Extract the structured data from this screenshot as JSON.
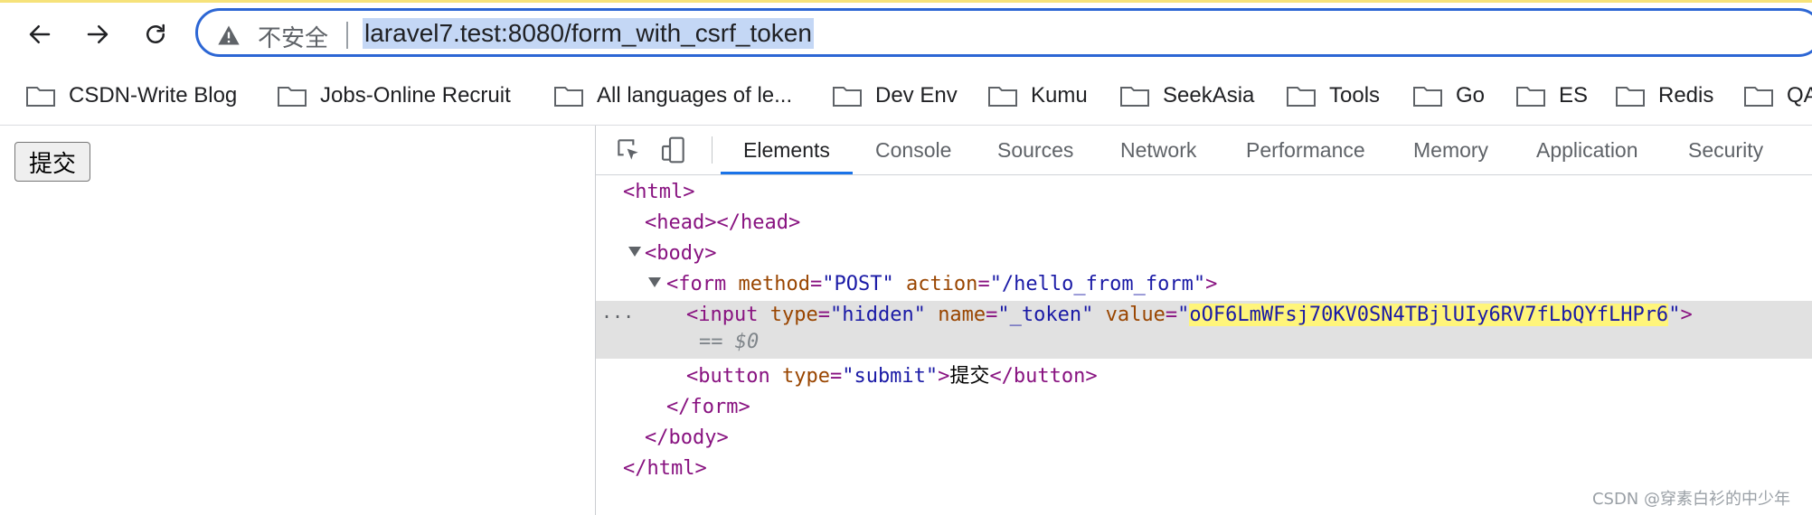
{
  "browser": {
    "nav": {
      "back_icon": "arrow-left-icon",
      "forward_icon": "arrow-right-icon",
      "reload_icon": "reload-icon"
    },
    "address_bar": {
      "security_label": "不安全",
      "url": "laravel7.test:8080/form_with_csrf_token"
    },
    "bookmarks": [
      "CSDN-Write Blog",
      "Jobs-Online Recruit",
      "All languages of le...",
      "Dev Env",
      "Kumu",
      "SeekAsia",
      "Tools",
      "Go",
      "ES",
      "Redis",
      "QA"
    ]
  },
  "page": {
    "submit_label": "提交"
  },
  "devtools": {
    "tabs": [
      "Elements",
      "Console",
      "Sources",
      "Network",
      "Performance",
      "Memory",
      "Application",
      "Security"
    ],
    "active_tab": "Elements",
    "dom": {
      "html_open": "<html>",
      "head": "<head></head>",
      "body_open": "<body>",
      "form_tag": "<form",
      "form_attr_method": "method",
      "form_val_method": "\"POST\"",
      "form_attr_action": "action",
      "form_val_action": "\"/hello_from_form\"",
      "form_close_bracket": ">",
      "input_tag": "<input",
      "input_attr_type": "type",
      "input_val_type": "\"hidden\"",
      "input_attr_name": "name",
      "input_val_name": "\"_token\"",
      "input_attr_value": "value",
      "input_val_quote_open": "\"",
      "token": "oOF6LmWFsj70KV0SN4TBjlUIy6RV7fLbQYfLHPr6",
      "input_val_quote_close": "\"",
      "input_close_bracket": ">",
      "eq_ref": "== $0",
      "button_tag": "<button",
      "button_attr_type": "type",
      "button_val_type": "\"submit\"",
      "button_gt": ">",
      "button_text": "提交",
      "button_close": "</button>",
      "form_close": "</form>",
      "body_close": "</body>",
      "html_close": "</html>",
      "more_dots": "..."
    }
  },
  "watermark": "CSDN @穿素白衫的中少年"
}
